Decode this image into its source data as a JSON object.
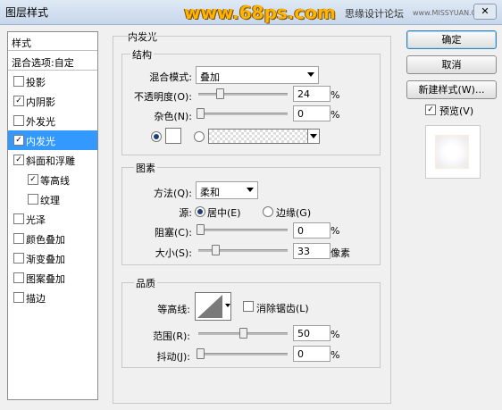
{
  "window": {
    "title": "图层样式",
    "close_glyph": "✕"
  },
  "watermark": {
    "text": "www.68ps.com",
    "site_text": "思缘设计论坛",
    "site_url": "www.MISSYUAN.COM"
  },
  "left_panel": {
    "header": "样式",
    "blend_options": "混合选项:自定",
    "items": [
      {
        "label": "投影",
        "checked": false,
        "selected": false,
        "indent": false
      },
      {
        "label": "内阴影",
        "checked": true,
        "selected": false,
        "indent": false
      },
      {
        "label": "外发光",
        "checked": false,
        "selected": false,
        "indent": false
      },
      {
        "label": "内发光",
        "checked": true,
        "selected": true,
        "indent": false
      },
      {
        "label": "斜面和浮雕",
        "checked": true,
        "selected": false,
        "indent": false
      },
      {
        "label": "等高线",
        "checked": true,
        "selected": false,
        "indent": true
      },
      {
        "label": "纹理",
        "checked": false,
        "selected": false,
        "indent": true
      },
      {
        "label": "光泽",
        "checked": false,
        "selected": false,
        "indent": false
      },
      {
        "label": "颜色叠加",
        "checked": false,
        "selected": false,
        "indent": false
      },
      {
        "label": "渐变叠加",
        "checked": false,
        "selected": false,
        "indent": false
      },
      {
        "label": "图案叠加",
        "checked": false,
        "selected": false,
        "indent": false
      },
      {
        "label": "描边",
        "checked": false,
        "selected": false,
        "indent": false
      }
    ]
  },
  "panel": {
    "title": "内发光",
    "structure": {
      "title": "结构",
      "blend_mode_label": "混合模式:",
      "blend_mode_value": "叠加",
      "opacity_label": "不透明度(O):",
      "opacity_value": "24",
      "opacity_unit": "%",
      "noise_label": "杂色(N):",
      "noise_value": "0",
      "noise_unit": "%",
      "color_swatch": "#ffffff"
    },
    "elements": {
      "title": "图素",
      "method_label": "方法(Q):",
      "method_value": "柔和",
      "source_label": "源:",
      "source_center": "居中(E)",
      "source_edge": "边缘(G)",
      "choke_label": "阻塞(C):",
      "choke_value": "0",
      "choke_unit": "%",
      "size_label": "大小(S):",
      "size_value": "33",
      "size_unit": "像素"
    },
    "quality": {
      "title": "品质",
      "contour_label": "等高线:",
      "antialias_label": "消除锯齿(L)",
      "range_label": "范围(R):",
      "range_value": "50",
      "range_unit": "%",
      "jitter_label": "抖动(J):",
      "jitter_value": "0",
      "jitter_unit": "%"
    }
  },
  "right_panel": {
    "ok_label": "确定",
    "cancel_label": "取消",
    "new_style_label": "新建样式(W)...",
    "preview_label": "预览(V)",
    "preview_checked": true
  }
}
